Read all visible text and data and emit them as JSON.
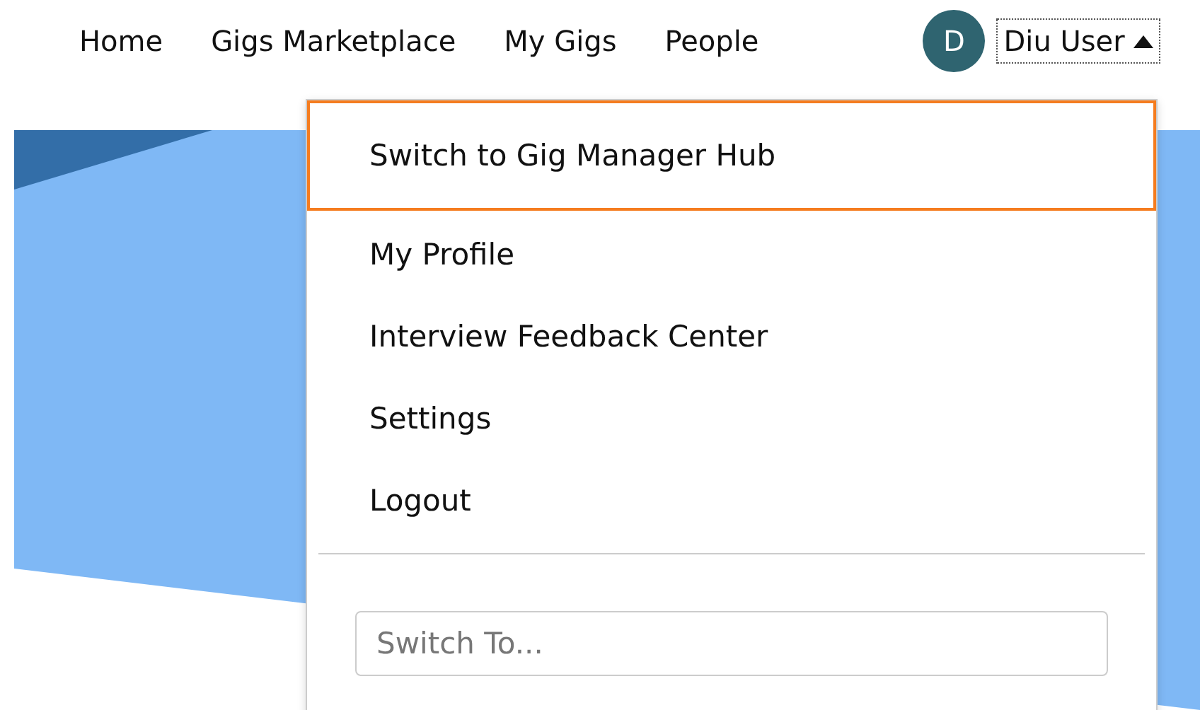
{
  "nav": {
    "links": [
      {
        "label": "Home"
      },
      {
        "label": "Gigs Marketplace"
      },
      {
        "label": "My Gigs"
      },
      {
        "label": "People"
      }
    ]
  },
  "user": {
    "initial": "D",
    "name": "Diu User",
    "expanded": true
  },
  "menu": {
    "items": [
      {
        "label": "Switch to Gig Manager Hub",
        "selected": true
      },
      {
        "label": "My Profile",
        "selected": false
      },
      {
        "label": "Interview Feedback Center",
        "selected": false
      },
      {
        "label": "Settings",
        "selected": false
      },
      {
        "label": "Logout",
        "selected": false
      }
    ],
    "search": {
      "placeholder": "Switch To..."
    }
  }
}
